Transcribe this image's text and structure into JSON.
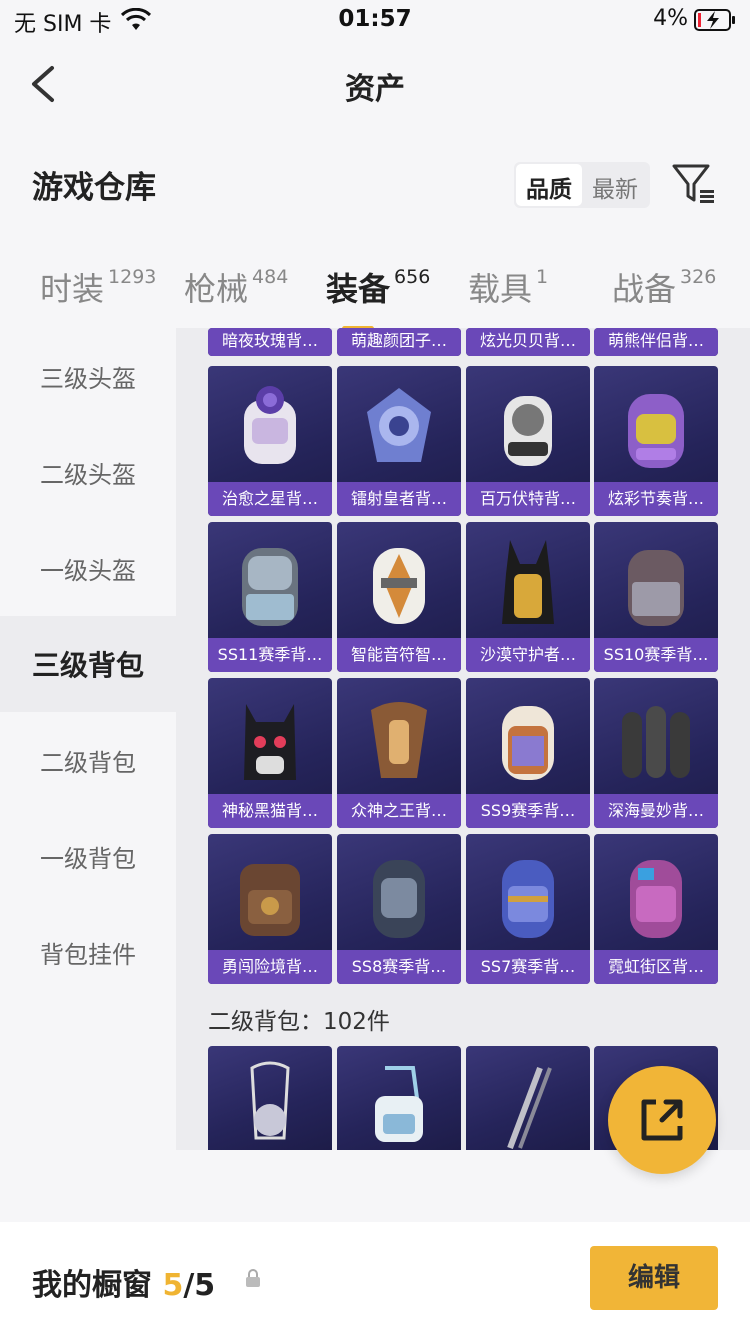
{
  "status": {
    "carrier": "无 SIM 卡",
    "time": "01:57",
    "battery": "4%"
  },
  "nav": {
    "title": "资产"
  },
  "header": {
    "section_title": "游戏仓库",
    "sort": [
      {
        "label": "品质",
        "active": true
      },
      {
        "label": "最新",
        "active": false
      }
    ]
  },
  "tabs": [
    {
      "label": "时装",
      "count": "1293"
    },
    {
      "label": "枪械",
      "count": "484"
    },
    {
      "label": "装备",
      "count": "656",
      "active": true
    },
    {
      "label": "载具",
      "count": "1"
    },
    {
      "label": "战备",
      "count": "326"
    }
  ],
  "sidebar": [
    {
      "label": "三级头盔"
    },
    {
      "label": "二级头盔"
    },
    {
      "label": "一级头盔"
    },
    {
      "label": "三级背包",
      "active": true
    },
    {
      "label": "二级背包"
    },
    {
      "label": "一级背包"
    },
    {
      "label": "背包挂件"
    }
  ],
  "items_top": [
    "暗夜玫瑰背…",
    "萌趣颜团子…",
    "炫光贝贝背…",
    "萌熊伴侣背…"
  ],
  "items": [
    [
      "治愈之星背…",
      "镭射皇者背…",
      "百万伏特背…",
      "炫彩节奏背…"
    ],
    [
      "SS11赛季背…",
      "智能音符智…",
      "沙漠守护者…",
      "SS10赛季背…"
    ],
    [
      "神秘黑猫背…",
      "众神之王背…",
      "SS9赛季背…",
      "深海曼妙背…"
    ],
    [
      "勇闯险境背…",
      "SS8赛季背…",
      "SS7赛季背…",
      "霓虹街区背…"
    ]
  ],
  "group2": {
    "title": "二级背包：102件"
  },
  "footer": {
    "label": "我的橱窗",
    "current": "5",
    "total": "/5",
    "edit": "编辑"
  },
  "colors": {
    "accent": "#f1b537",
    "card_bg": "#2c2a66",
    "card_label": "#6a48b8"
  }
}
